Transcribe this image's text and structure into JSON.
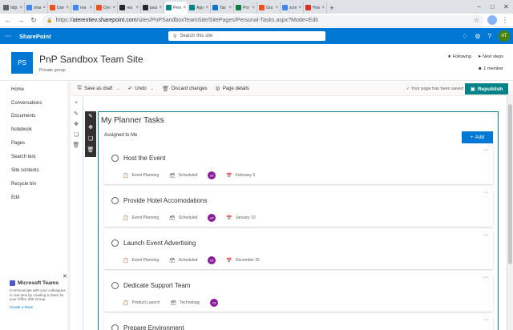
{
  "browser": {
    "tabs": [
      {
        "label": "https:",
        "color": "#5f6368",
        "active": false
      },
      {
        "label": "shar",
        "color": "#4285f4",
        "active": false
      },
      {
        "label": "Use",
        "color": "#f25022",
        "active": false
      },
      {
        "label": "rea",
        "color": "#4285f4",
        "active": false
      },
      {
        "label": "Dyn",
        "color": "#f25022",
        "active": false
      },
      {
        "label": "rea",
        "color": "#24292e",
        "active": false
      },
      {
        "label": "java",
        "color": "#24292e",
        "active": false
      },
      {
        "label": "Pers",
        "color": "#038387",
        "active": true
      },
      {
        "label": "App",
        "color": "#038387",
        "active": false
      },
      {
        "label": "Tas",
        "color": "#0078d4",
        "active": false
      },
      {
        "label": "Pro",
        "color": "#107c41",
        "active": false
      },
      {
        "label": "Gra",
        "color": "#f25022",
        "active": false
      },
      {
        "label": "scre",
        "color": "#4285f4",
        "active": false
      },
      {
        "label": "How",
        "color": "#d93025",
        "active": false
      }
    ],
    "new_tab": "+",
    "url_prefix": "https://",
    "url_host": "aterentiev.sharepoint.com",
    "url_path": "/sites/PnPSandboxTeamSite/SitePages/Personal-Tasks.aspx?Mode=Edit"
  },
  "suite": {
    "brand": "SharePoint",
    "search_placeholder": "Search this site"
  },
  "me_initials": "AT",
  "site": {
    "logo": "PS",
    "title": "PnP Sandbox Team Site",
    "subtitle": "Private group",
    "following": "Following",
    "next_steps": "Next steps",
    "members": "1 member"
  },
  "leftnav": [
    "Home",
    "Conversations",
    "Documents",
    "Notebook",
    "Pages",
    "Search test",
    "Site contents",
    "Recycle bin",
    "Edit"
  ],
  "teams_promo": {
    "title": "Microsoft Teams",
    "text": "Communicate with your colleagues in real time by creating a Team for your Office 365 Group.",
    "link": "Create a Team"
  },
  "cmdbar": {
    "save_as_draft": "Save as draft",
    "undo": "Undo",
    "discard": "Discard changes",
    "page_details": "Page details",
    "status": "Your page has been saved",
    "republish": "Republish"
  },
  "webpart": {
    "title": "My Planner Tasks",
    "subtitle": "Assigned to Me",
    "add_label": "Add"
  },
  "tasks": [
    {
      "title": "Host the Event",
      "plan": "Event Planning",
      "bucket": "Scheduled",
      "assignee": "AT",
      "due": "February 3"
    },
    {
      "title": "Provide Hotel Accomodations",
      "plan": "Event Planning",
      "bucket": "Scheduled",
      "assignee": "AT",
      "due": "January 10"
    },
    {
      "title": "Launch Event Advertising",
      "plan": "Event Planning",
      "bucket": "Scheduled",
      "assignee": "AT",
      "due": "December 25"
    },
    {
      "title": "Dedicate Support Team",
      "plan": "Product Launch",
      "bucket": "Technology",
      "assignee": "AT",
      "due": ""
    },
    {
      "title": "Prepare Environment",
      "plan": "",
      "bucket": "",
      "assignee": "",
      "due": ""
    }
  ],
  "colors": {
    "suite_blue": "#0078d4",
    "teal": "#038387",
    "assignee_purple": "#8a1a9b"
  }
}
